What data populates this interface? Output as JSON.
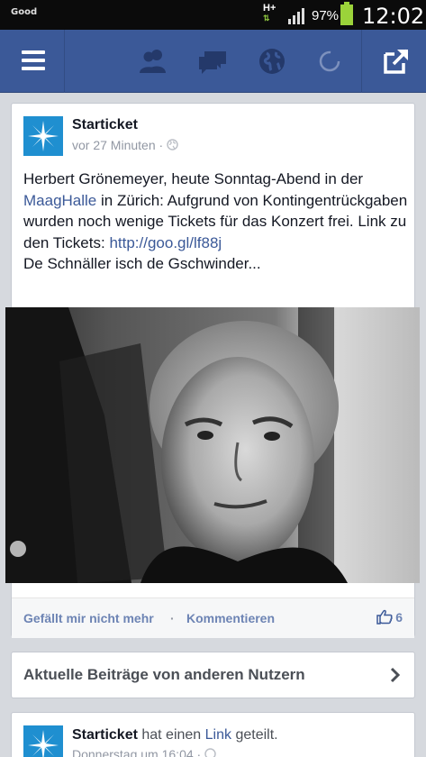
{
  "status_bar": {
    "carrier": "Good",
    "network": "H+",
    "battery_percent": "97%",
    "battery_level": 0.97,
    "time": "12:02"
  },
  "app_bar": {
    "icons": [
      "menu-icon",
      "friend-requests-icon",
      "messages-icon",
      "notifications-globe-icon",
      "loading-spinner-icon",
      "share-icon"
    ]
  },
  "post": {
    "author": "Starticket",
    "time_ago": "vor 27 Minuten",
    "meta_separator": "·",
    "text_part1": "Herbert Grönemeyer, heute Sonntag-Abend in der ",
    "link_venue": "MaagHalle",
    "text_part2": " in Zürich: Aufgrund von Kontingentrückgaben wurden noch wenige Tickets für das Konzert frei. Link zu den Tickets: ",
    "link_url": "http://goo.gl/lf88j",
    "text_part3": "De Schnäller isch de Gschwinder...",
    "actions": {
      "unlike": "Gefällt mir nicht mehr",
      "separator": "·",
      "comment": "Kommentieren",
      "likes_count": "6"
    }
  },
  "recent_posts": {
    "label": "Aktuelle Beiträge von anderen Nutzern"
  },
  "post2": {
    "author": "Starticket",
    "action_pre": " hat einen ",
    "action_link": "Link",
    "action_post": " geteilt.",
    "time": "Donnerstag um 16:04",
    "meta_separator": "·"
  },
  "colors": {
    "brand_blue": "#3b5998",
    "background": "#d6d9de",
    "link": "#3b5998",
    "action_text": "#6d84b4"
  }
}
